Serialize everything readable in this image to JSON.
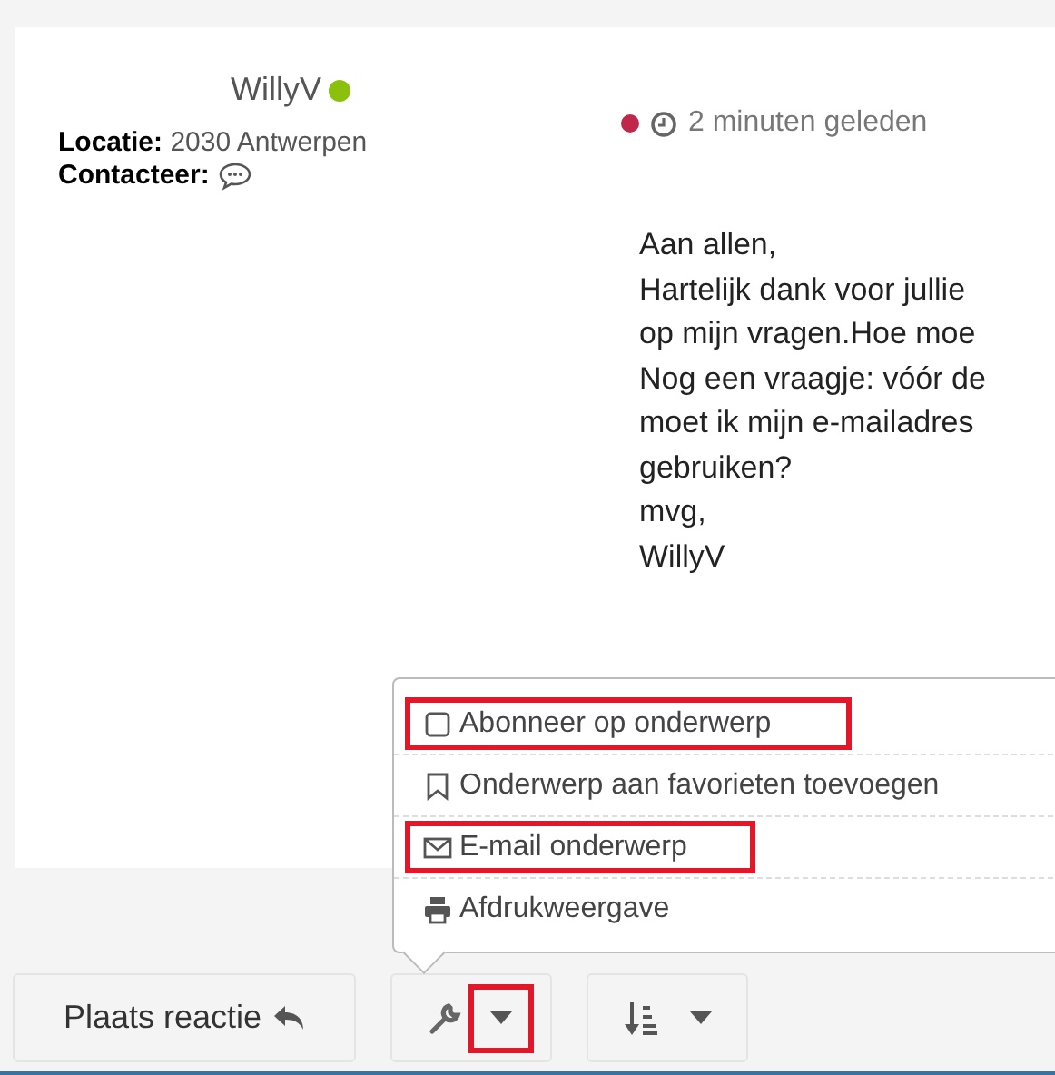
{
  "post": {
    "author": "WillyV",
    "online": true,
    "location_label": "Locatie:",
    "location": "2030 Antwerpen",
    "contact_label": "Contacteer:",
    "unread": true,
    "time": "2 minuten geleden",
    "body": [
      "Aan allen,",
      "Hartelijk dank voor jullie",
      "op mijn vragen.Hoe moe",
      "Nog een vraagje: vóór de",
      "moet ik mijn e-mailadres",
      "gebruiken?",
      "mvg,",
      "WillyV"
    ]
  },
  "menu": {
    "items": [
      {
        "kind": "checkbox",
        "label": "Abonneer op onderwerp",
        "highlighted": true
      },
      {
        "kind": "bookmark",
        "label": "Onderwerp aan favorieten toevoegen",
        "highlighted": false
      },
      {
        "kind": "mail",
        "label": "E-mail onderwerp",
        "highlighted": true
      },
      {
        "kind": "print",
        "label": "Afdrukweergave",
        "highlighted": false
      }
    ]
  },
  "toolbar": {
    "reply": "Plaats reactie",
    "tools_caret_highlighted": true
  }
}
